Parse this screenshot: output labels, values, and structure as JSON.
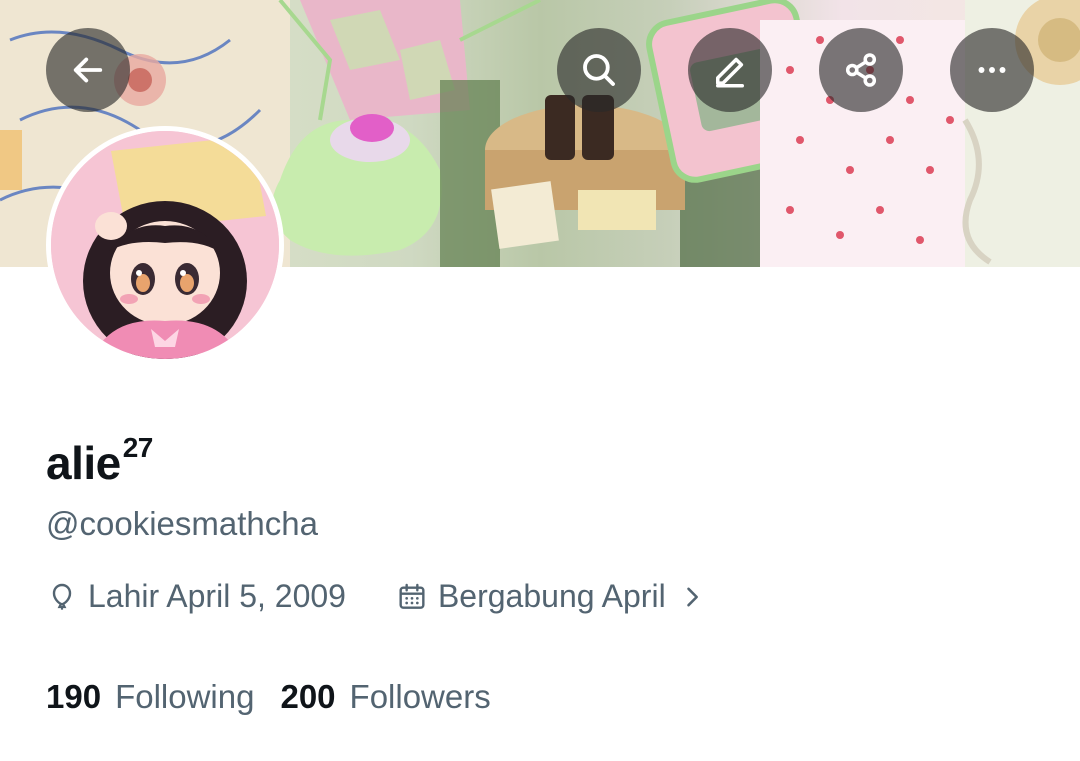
{
  "profile": {
    "display_name": "alie",
    "display_name_sup": "27",
    "handle": "@cookiesmathcha",
    "birthday": "Lahir April 5, 2009",
    "joined": "Bergabung April",
    "following_count": "190",
    "following_label": "Following",
    "followers_count": "200",
    "followers_label": "Followers"
  },
  "toolbar": {
    "back_icon": "arrow-left-icon",
    "search_icon": "search-icon",
    "edit_icon": "edit-icon",
    "share_icon": "share-icon",
    "more_icon": "more-horizontal-icon"
  },
  "colors": {
    "primary_text": "#0f1419",
    "secondary_text": "#536471",
    "button_overlay": "rgba(40,40,40,0.62)",
    "background": "#ffffff"
  }
}
